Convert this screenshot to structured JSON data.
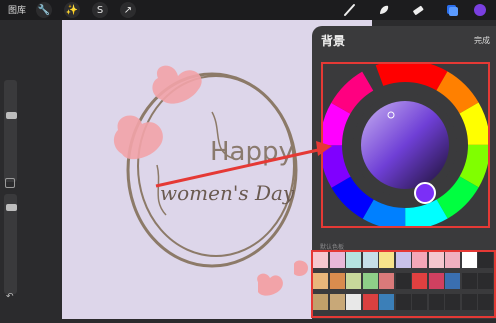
{
  "topbar": {
    "gallery_label": "图库",
    "icons": [
      "wrench-icon",
      "magic-wand-icon",
      "selection-icon",
      "transform-arrow-icon"
    ],
    "tools": [
      "brush-icon",
      "smudge-icon",
      "eraser-icon",
      "layers-icon",
      "color-dot-icon"
    ],
    "active_color": "#7a3fe0"
  },
  "canvas": {
    "text_line1": "Happy",
    "text_line2": "women's Day",
    "background_color": "#ddd6ea",
    "text1_color": "#8a7a6e",
    "text2_color": "#6a5a50"
  },
  "panel": {
    "title": "背景",
    "done_label": "完成",
    "palette_caption": "默认色板",
    "selected_color": "#7b2ff7",
    "palette": [
      [
        "#f6c8cf",
        "#e8b8d8",
        "#b5e3e0",
        "#c7dfe8",
        "#f7e38b",
        "#c9c2ea",
        "#f3a7b8",
        "#f4c6ce",
        "#f0b0c0",
        "#ffffff",
        "#2b2b2d"
      ],
      [
        "#e9b77b",
        "#d98c4e",
        "#c8d89a",
        "#8fcf88",
        "#d97a7a",
        "#2b2b2d",
        "#e04040",
        "#d04060",
        "#3a6fb0",
        "#2b2b2d",
        "#2b2b2d"
      ],
      [
        "#c2a06a",
        "#c8a878",
        "#e8e8e8",
        "#d94040",
        "#3b7fb8",
        "#2b2b2d",
        "#2b2b2d",
        "#2b2b2d",
        "#2b2b2d",
        "#2b2b2d",
        "#2b2b2d"
      ]
    ]
  }
}
